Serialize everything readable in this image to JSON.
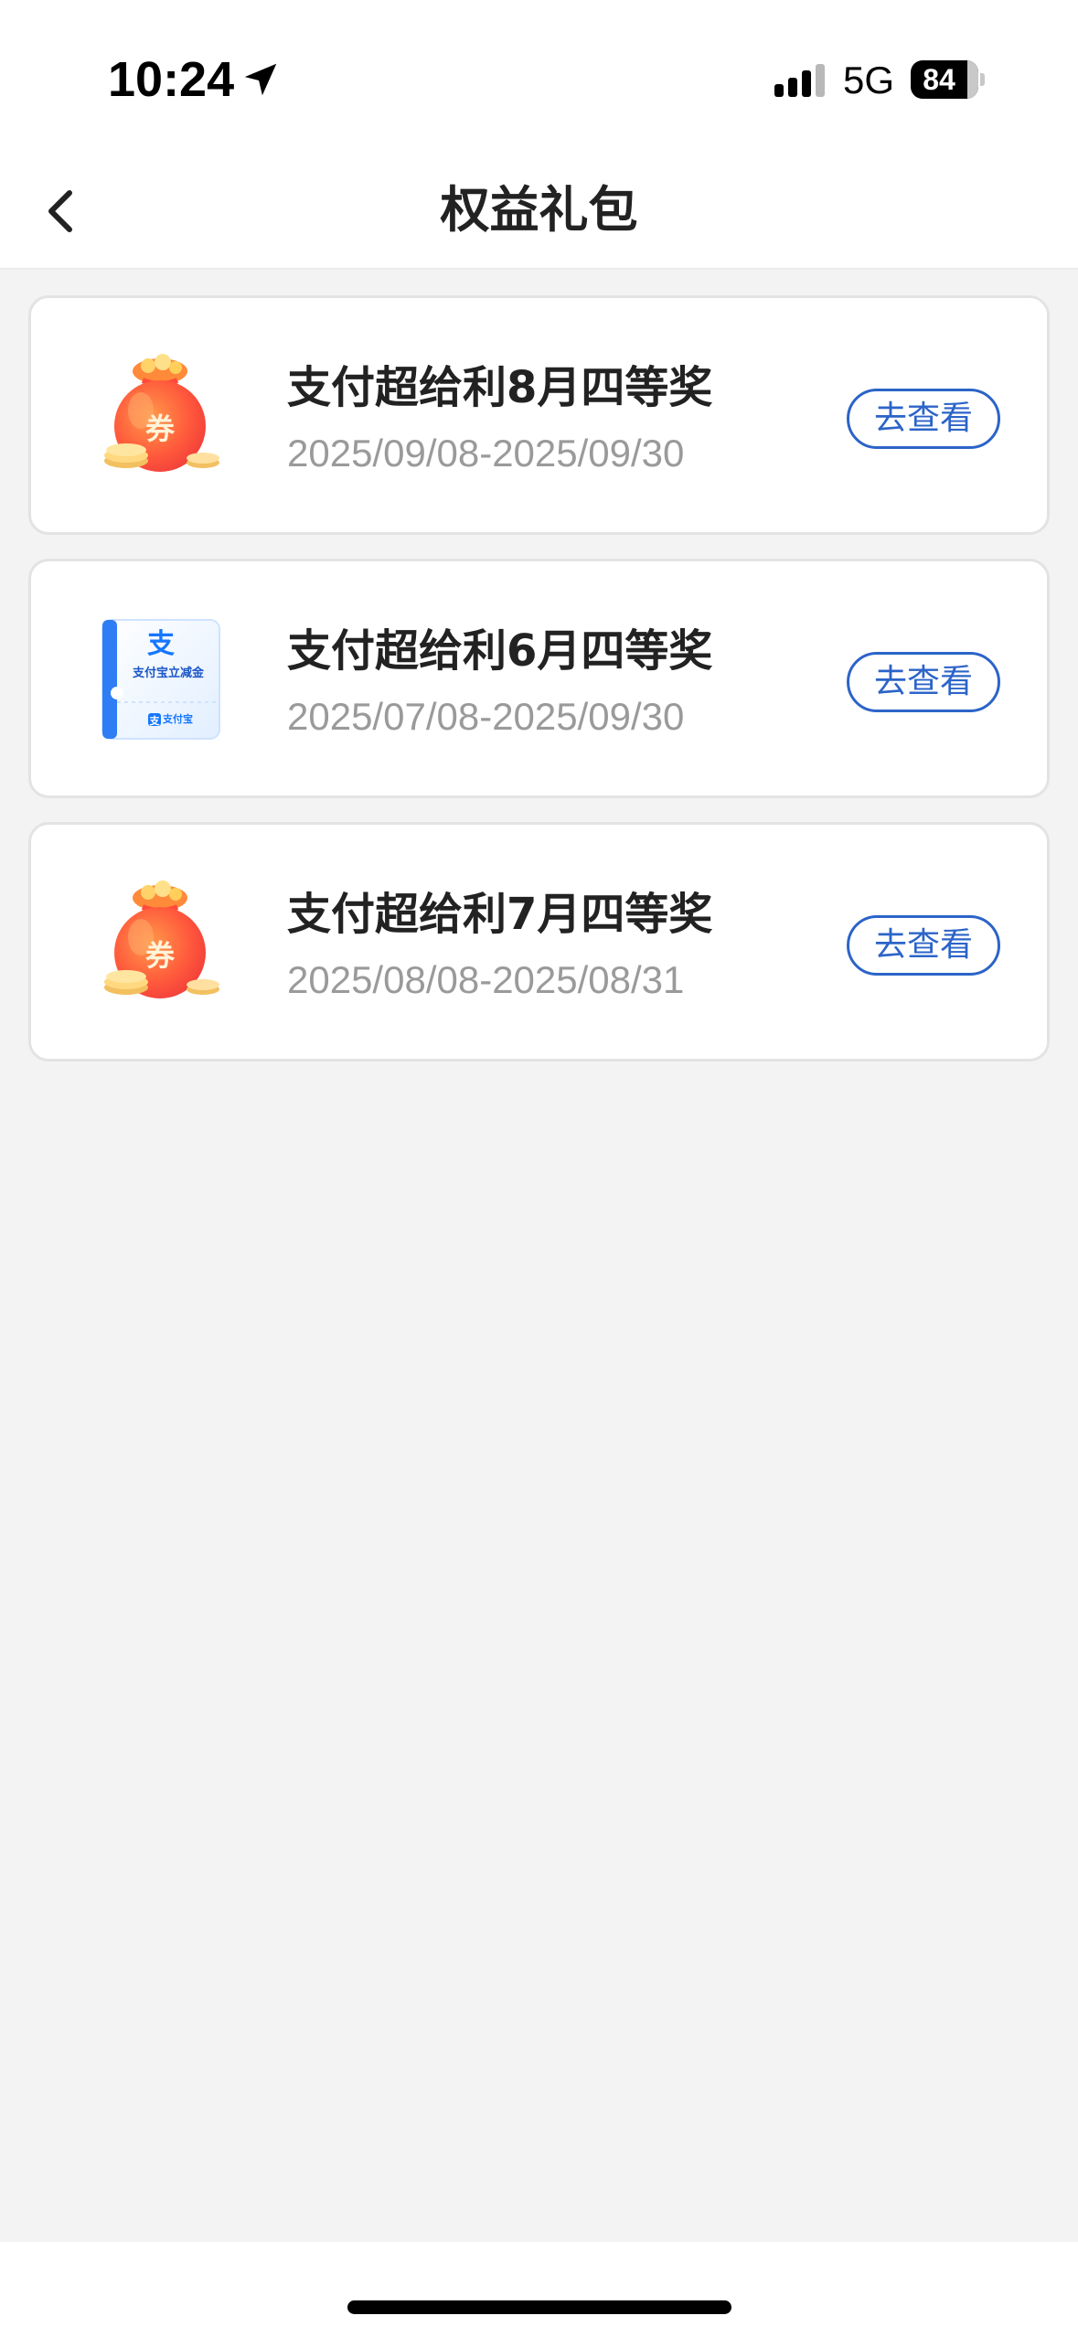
{
  "status_bar": {
    "time": "10:24",
    "network": "5G",
    "battery": "84"
  },
  "nav": {
    "title": "权益礼包"
  },
  "items": [
    {
      "title": "支付超给利8月四等奖",
      "date": "2025/09/08-2025/09/30",
      "icon": "coupon-bag-icon",
      "icon_text": "券",
      "button": "去查看"
    },
    {
      "title": "支付超给利6月四等奖",
      "date": "2025/07/08-2025/09/30",
      "icon": "alipay-voucher-icon",
      "icon_text": "支付宝立减金",
      "icon_brand": "支付宝",
      "button": "去查看"
    },
    {
      "title": "支付超给利7月四等奖",
      "date": "2025/08/08-2025/08/31",
      "icon": "coupon-bag-icon",
      "icon_text": "券",
      "button": "去查看"
    }
  ],
  "colors": {
    "accent": "#2c64c8",
    "background": "#f3f3f3",
    "card_border": "#e3e3e3",
    "bag_red": "#ff4d3a",
    "bag_orange": "#ffb040",
    "alipay_blue": "#1677ff"
  }
}
